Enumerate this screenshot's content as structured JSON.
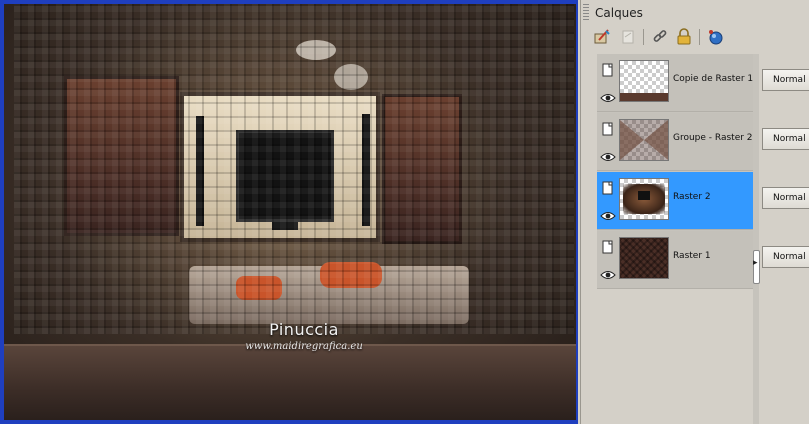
{
  "canvas": {
    "watermark_title": "Pinuccia",
    "watermark_url": "www.maidiregrafica.eu"
  },
  "palette": {
    "title": "Calques",
    "toolbar": [
      {
        "name": "edit-layer-icon"
      },
      {
        "name": "disabled-layer-icon"
      },
      {
        "name": "link-icon"
      },
      {
        "name": "lock-icon"
      },
      {
        "name": "mask-globe-icon"
      }
    ],
    "layers": [
      {
        "name": "Copie de Raster 1",
        "blend": "Normal",
        "selected": false
      },
      {
        "name": "Groupe - Raster 2",
        "blend": "Normal",
        "selected": false
      },
      {
        "name": "Raster 2",
        "blend": "Normal",
        "selected": true
      },
      {
        "name": "Raster 1",
        "blend": "Normal",
        "selected": false
      }
    ]
  },
  "colors": {
    "canvas_border": "#1f3fbf",
    "selection": "#3399ff",
    "panel_bg": "#d4d0c8"
  }
}
